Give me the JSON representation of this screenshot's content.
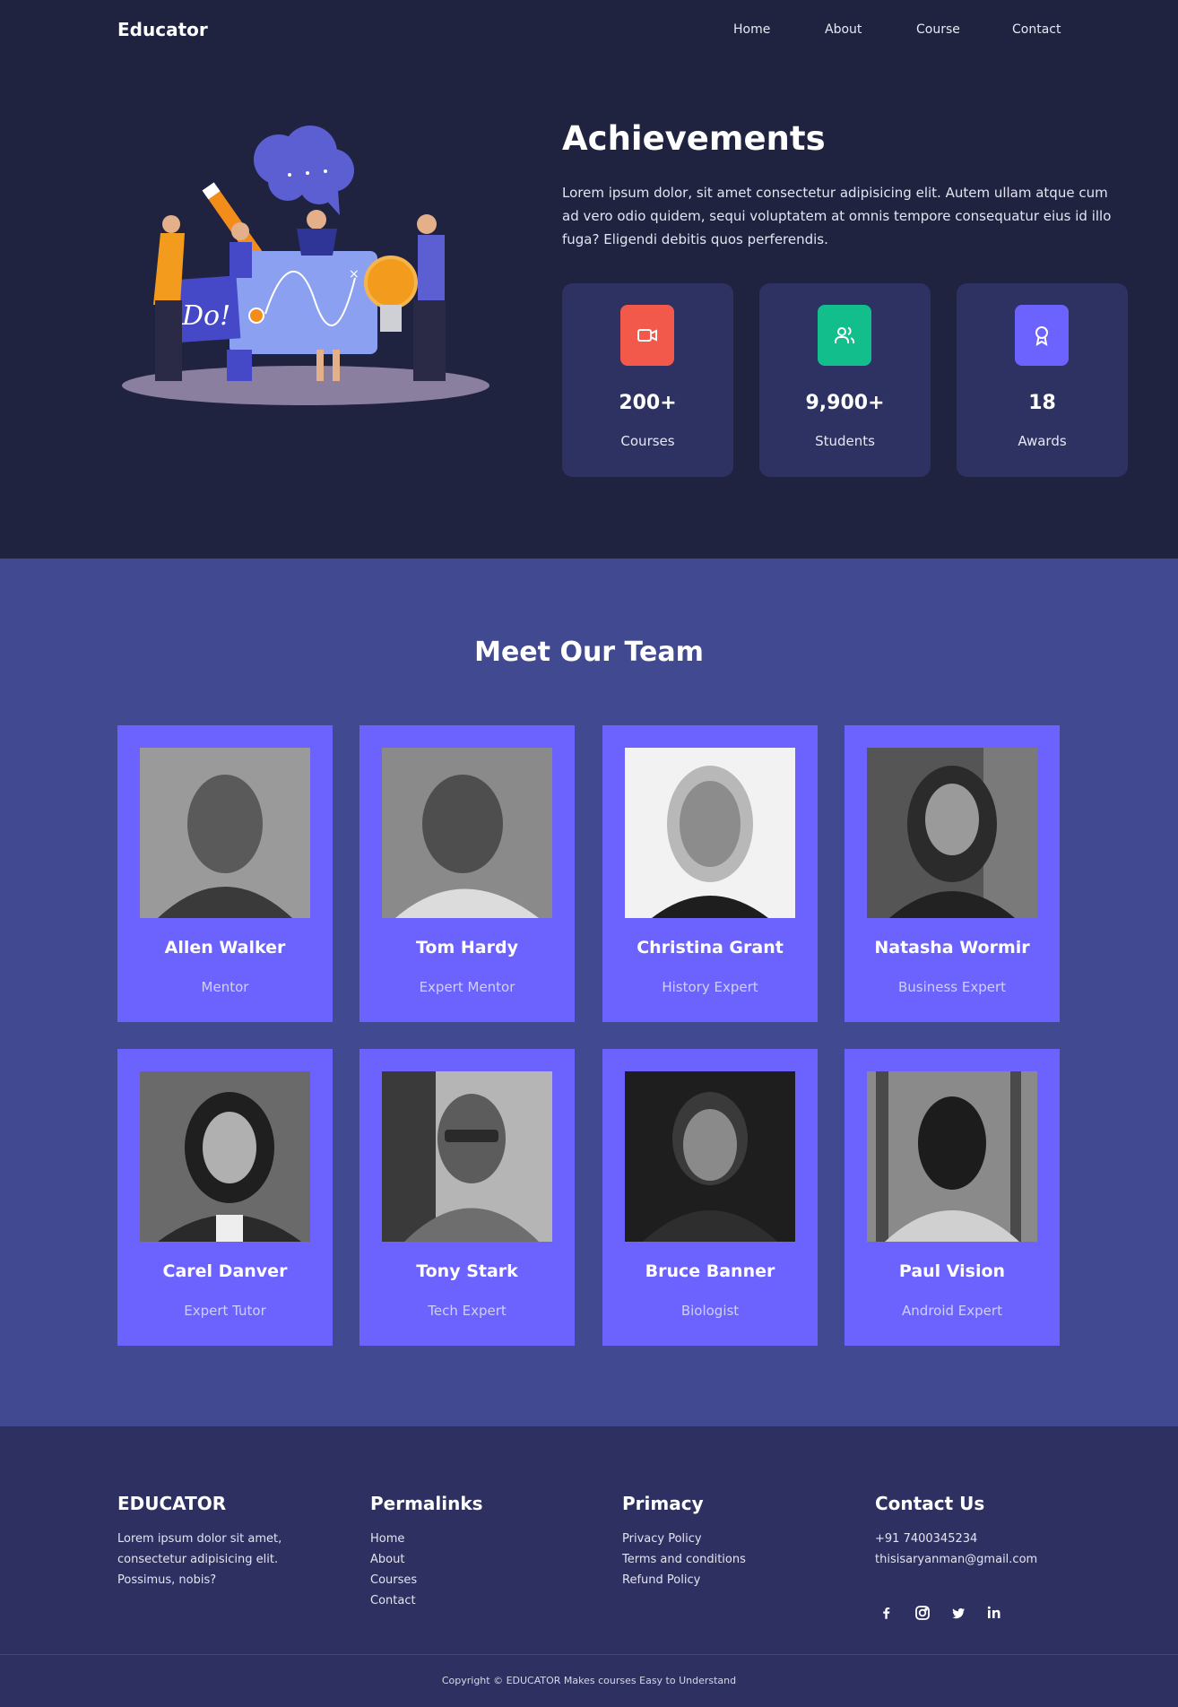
{
  "header": {
    "logo": "Educator",
    "nav": [
      "Home",
      "About",
      "Course",
      "Contact"
    ]
  },
  "achievements": {
    "title": "Achievements",
    "text": "Lorem ipsum dolor, sit amet consectetur adipisicing elit. Autem ullam atque cum ad vero odio quidem, sequi voluptatem at omnis tempore consequatur eius id illo fuga? Eligendi debitis quos perferendis.",
    "illustration_text": "Do!",
    "stats": [
      {
        "value": "200+",
        "label": "Courses",
        "icon": "video-camera-icon",
        "color": "#f2594b"
      },
      {
        "value": "9,900+",
        "label": "Students",
        "icon": "users-icon",
        "color": "#13be8d"
      },
      {
        "value": "18",
        "label": "Awards",
        "icon": "award-ribbon-icon",
        "color": "#6c63ff"
      }
    ]
  },
  "team": {
    "title": "Meet Our Team",
    "members": [
      {
        "name": "Allen Walker",
        "role": "Mentor"
      },
      {
        "name": "Tom Hardy",
        "role": "Expert Mentor"
      },
      {
        "name": "Christina Grant",
        "role": "History Expert"
      },
      {
        "name": "Natasha Wormir",
        "role": "Business Expert"
      },
      {
        "name": "Carel Danver",
        "role": "Expert Tutor"
      },
      {
        "name": "Tony Stark",
        "role": "Tech Expert"
      },
      {
        "name": "Bruce Banner",
        "role": "Biologist"
      },
      {
        "name": "Paul Vision",
        "role": "Android Expert"
      }
    ]
  },
  "footer": {
    "brand": {
      "title": "EDUCATOR",
      "text": "Lorem ipsum dolor sit amet, consectetur adipisicing elit. Possimus, nobis?"
    },
    "permalinks": {
      "title": "Permalinks",
      "links": [
        "Home",
        "About",
        "Courses",
        "Contact"
      ]
    },
    "primacy": {
      "title": "Primacy",
      "links": [
        "Privacy Policy",
        "Terms and conditions",
        "Refund Policy"
      ]
    },
    "contact": {
      "title": "Contact Us",
      "phone": "+91 7400345234",
      "email": "thisisaryanman@gmail.com",
      "social": [
        "facebook-icon",
        "instagram-icon",
        "twitter-icon",
        "linkedin-icon"
      ]
    },
    "copyright": "Copyright © EDUCATOR Makes courses Easy to Understand"
  },
  "colors": {
    "dark_bg": "#1f2340",
    "team_bg": "#414991",
    "card_bg": "#6c63ff",
    "footer_bg": "#2d3060",
    "stat_card": "#2e3262"
  }
}
